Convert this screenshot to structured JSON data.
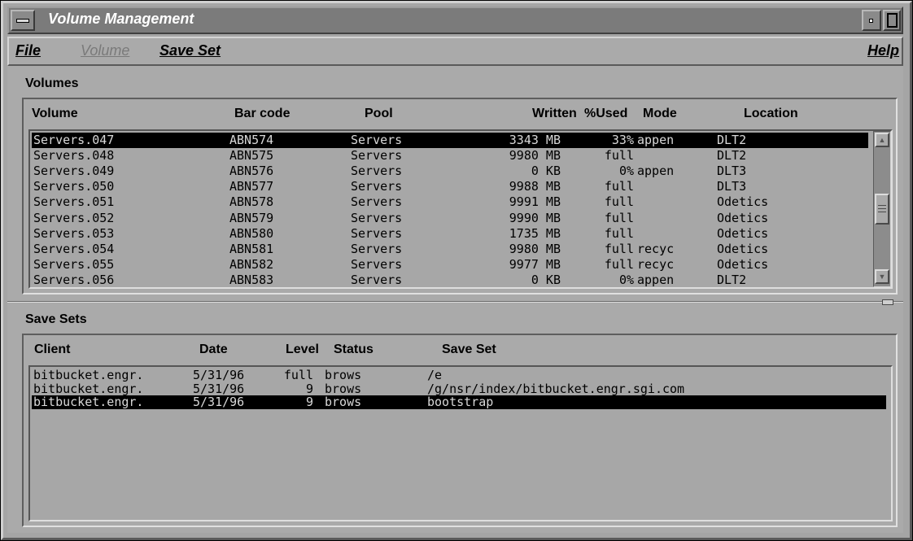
{
  "window": {
    "title": "Volume Management"
  },
  "menubar": {
    "file": "File",
    "volume": "Volume",
    "save_set": "Save Set",
    "help": "Help"
  },
  "volumes": {
    "section_label": "Volumes",
    "columns": {
      "volume": "Volume",
      "barcode": "Bar code",
      "pool": "Pool",
      "written": "Written",
      "used": "%Used",
      "mode": "Mode",
      "location": "Location"
    },
    "rows": [
      {
        "volume": "Servers.047",
        "barcode": "ABN574",
        "pool": "Servers",
        "written": "3343 MB",
        "used": "33%",
        "mode": "appen",
        "location": "DLT2",
        "selected": true
      },
      {
        "volume": "Servers.048",
        "barcode": "ABN575",
        "pool": "Servers",
        "written": "9980 MB",
        "used": "full",
        "mode": "",
        "location": "DLT2"
      },
      {
        "volume": "Servers.049",
        "barcode": "ABN576",
        "pool": "Servers",
        "written": "0 KB",
        "used": "0%",
        "mode": "appen",
        "location": "DLT3"
      },
      {
        "volume": "Servers.050",
        "barcode": "ABN577",
        "pool": "Servers",
        "written": "9988 MB",
        "used": "full",
        "mode": "",
        "location": "DLT3"
      },
      {
        "volume": "Servers.051",
        "barcode": "ABN578",
        "pool": "Servers",
        "written": "9991 MB",
        "used": "full",
        "mode": "",
        "location": "Odetics"
      },
      {
        "volume": "Servers.052",
        "barcode": "ABN579",
        "pool": "Servers",
        "written": "9990 MB",
        "used": "full",
        "mode": "",
        "location": "Odetics"
      },
      {
        "volume": "Servers.053",
        "barcode": "ABN580",
        "pool": "Servers",
        "written": "1735 MB",
        "used": "full",
        "mode": "",
        "location": "Odetics"
      },
      {
        "volume": "Servers.054",
        "barcode": "ABN581",
        "pool": "Servers",
        "written": "9980 MB",
        "used": "full",
        "mode": "recyc",
        "location": "Odetics"
      },
      {
        "volume": "Servers.055",
        "barcode": "ABN582",
        "pool": "Servers",
        "written": "9977 MB",
        "used": "full",
        "mode": "recyc",
        "location": "Odetics"
      },
      {
        "volume": "Servers.056",
        "barcode": "ABN583",
        "pool": "Servers",
        "written": "0 KB",
        "used": "0%",
        "mode": "appen",
        "location": "DLT2"
      }
    ]
  },
  "save_sets": {
    "section_label": "Save Sets",
    "columns": {
      "client": "Client",
      "date": "Date",
      "level": "Level",
      "status": "Status",
      "save_set": "Save Set"
    },
    "rows": [
      {
        "client": "bitbucket.engr.",
        "date": "5/31/96",
        "level": "full",
        "status": "brows",
        "save_set": "/e"
      },
      {
        "client": "bitbucket.engr.",
        "date": "5/31/96",
        "level": "9",
        "status": "brows",
        "save_set": "/g/nsr/index/bitbucket.engr.sgi.com"
      },
      {
        "client": "bitbucket.engr.",
        "date": "5/31/96",
        "level": "9",
        "status": "brows",
        "save_set": "bootstrap",
        "selected": true
      }
    ]
  },
  "colors": {
    "window_bg": "#aaaaaa",
    "title_bar": "#7b7b7b",
    "selection_bg": "#000000",
    "selection_fg": "#d8d8d8",
    "list_bg": "#a7a7a7"
  }
}
